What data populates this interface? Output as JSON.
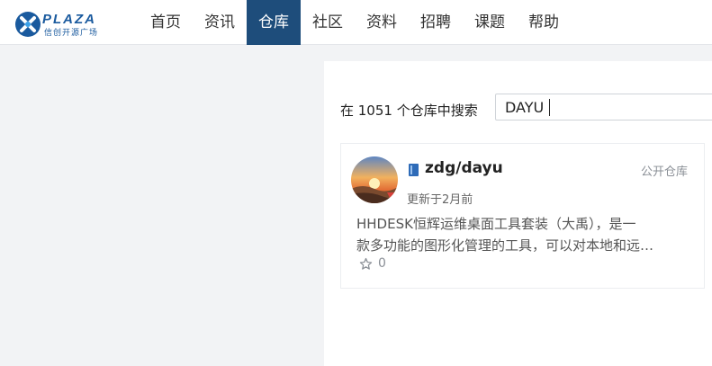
{
  "brand": {
    "word": "PLAZA",
    "sub": "信创开源广场"
  },
  "nav": {
    "items": [
      {
        "label": "首页"
      },
      {
        "label": "资讯"
      },
      {
        "label": "仓库"
      },
      {
        "label": "社区"
      },
      {
        "label": "资料"
      },
      {
        "label": "招聘"
      },
      {
        "label": "课题"
      },
      {
        "label": "帮助"
      }
    ],
    "active_index": 2
  },
  "search": {
    "label": "在 1051 个仓库中搜索",
    "value": "DAYU"
  },
  "results": [
    {
      "name": "zdg/dayu",
      "type": "公开仓库",
      "updated": "更新于2月前",
      "description_lines": [
        "HHDESK恒辉运维桌面工具套装（大禹），是一",
        "款多功能的图形化管理的工具，可以对本地和远…"
      ],
      "stars": "0"
    }
  ],
  "colors": {
    "brand": "#1a5a9e",
    "nav_active": "#1e4d7b",
    "repo_icon": "#2e6bb8"
  },
  "icons": {
    "logo": "x-logo-icon",
    "repo": "repo-book-icon",
    "star": "star-outline-icon"
  }
}
